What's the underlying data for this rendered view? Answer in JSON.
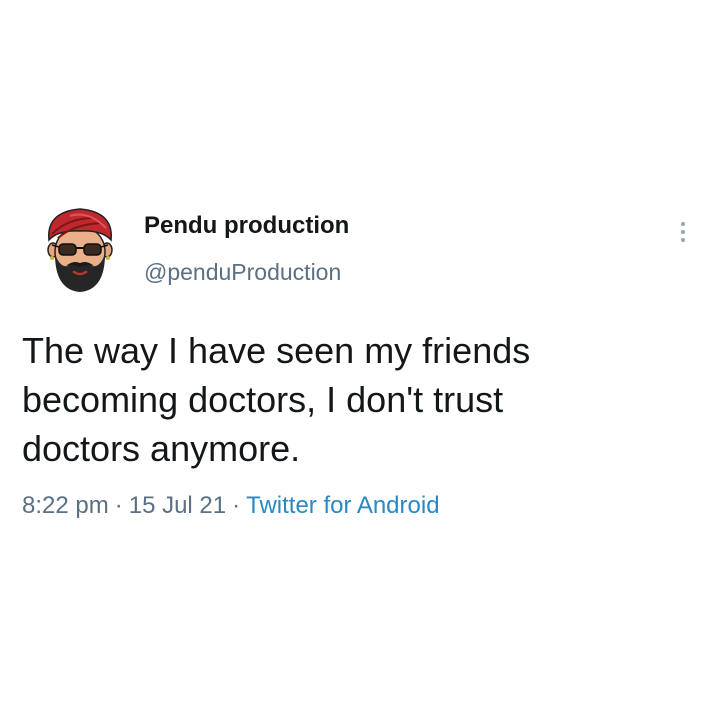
{
  "author": {
    "name": "Pendu production",
    "handle": "@penduProduction",
    "avatar_icon": "turbaned-man-avatar-icon"
  },
  "menu": {
    "icon": "more-vertical-icon"
  },
  "tweet": {
    "lines": [
      "The way I have seen my friends",
      "becoming doctors, I don't trust",
      "doctors anymore."
    ]
  },
  "meta": {
    "time": "8:22 pm",
    "separator": "·",
    "date": "15 Jul 21",
    "source": "Twitter for Android"
  },
  "colors": {
    "text": "#14171a",
    "secondary": "#5b7083",
    "link": "#2a89c4",
    "turban": "#c0282d",
    "background": "#ffffff"
  }
}
